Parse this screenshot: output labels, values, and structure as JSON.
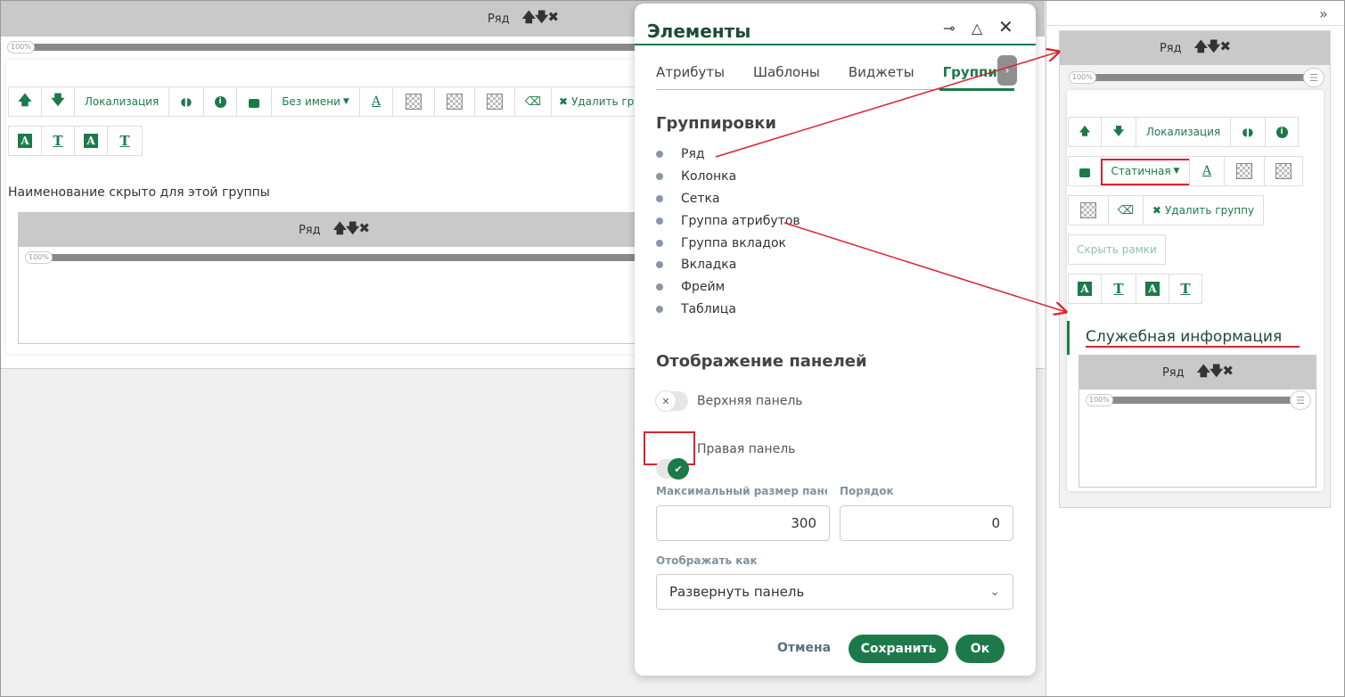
{
  "colors": {
    "accent": "#1c7a4a",
    "annotation": "#d9242f"
  },
  "canvas": {
    "row_label": "Ряд",
    "progress": "100%",
    "toolbar": {
      "localization": "Локализация",
      "no_name": "Без имени",
      "delete_group": "Удалить групп"
    },
    "hidden_name_text": "Наименование скрыто для этой группы",
    "inner_row": {
      "label": "Ряд",
      "progress": "100%"
    }
  },
  "modal": {
    "title": "Элементы",
    "tabs": [
      {
        "label": "Атрибуты"
      },
      {
        "label": "Шаблоны"
      },
      {
        "label": "Виджеты"
      },
      {
        "label": "Группиро"
      }
    ],
    "groups_heading": "Группировки",
    "groups": [
      "Ряд",
      "Колонка",
      "Сетка",
      "Группа атрибутов",
      "Группа вкладок",
      "Вкладка",
      "Фрейм",
      "Таблица"
    ],
    "panels_heading": "Отображение панелей",
    "top_panel_label": "Верхняя панель",
    "right_panel_label": "Правая панель",
    "max_size_label": "Максимальный размер пане...",
    "max_size_value": "300",
    "order_label": "Порядок",
    "order_value": "0",
    "display_as_label": "Отображать как",
    "display_as_value": "Развернуть панель",
    "cancel_label": "Отмена",
    "save_label": "Сохранить",
    "ok_label": "Ок"
  },
  "right_panel": {
    "collapse_icon": "»",
    "row_label": "Ряд",
    "progress": "100%",
    "localization": "Локализация",
    "static_label": "Статичная",
    "delete_group": "Удалить группу",
    "hide_frames": "Скрыть рамки",
    "service_info_title": "Служебная информация",
    "inner_row_label": "Ряд",
    "inner_progress": "100%"
  }
}
